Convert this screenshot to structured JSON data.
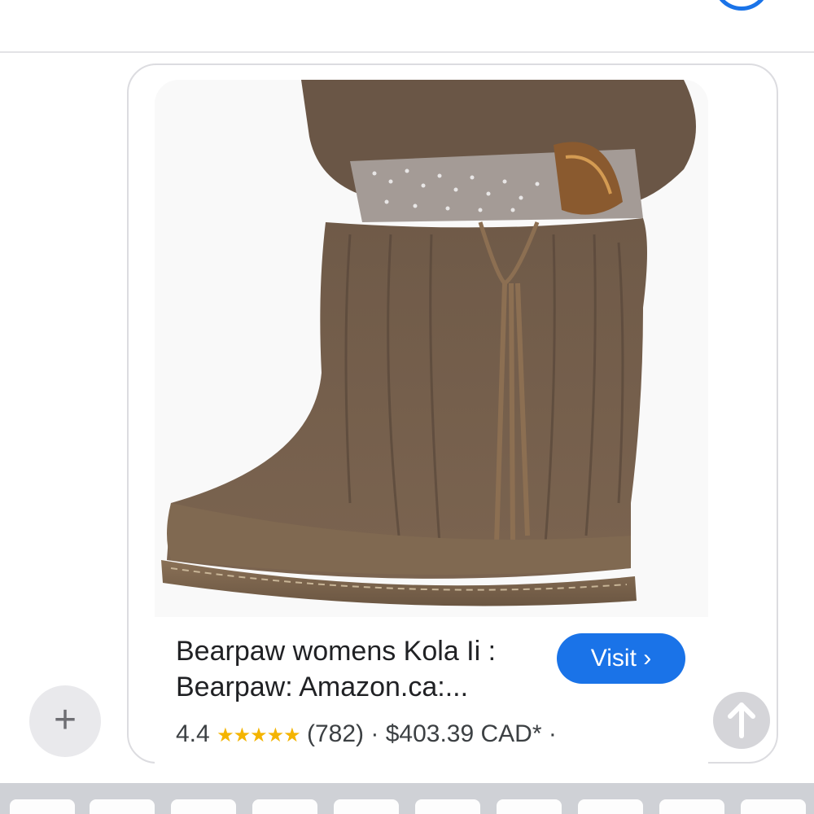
{
  "header": {
    "top_icon": "blue-ring-icon",
    "accent_color": "#1a73e8"
  },
  "card": {
    "image_alt": "brown fur boot with feather trim and leather tassel",
    "title": "Bearpaw womens Kola Ii : Bearpaw: Amazon.ca:...",
    "visit_label": "Visit ›",
    "rating": "4.4",
    "stars": "★★★★★",
    "review_count": "(782)",
    "price": "$403.39 CAD*",
    "separator": "·"
  },
  "compose": {
    "plus_icon": "+",
    "send_icon": "up-arrow-icon"
  }
}
